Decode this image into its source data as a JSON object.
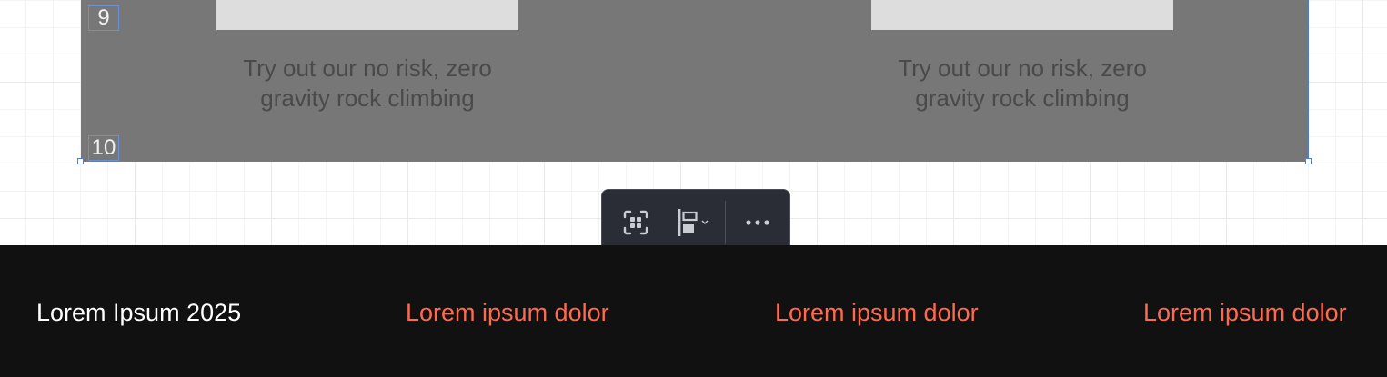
{
  "builder": {
    "row_numbers": [
      "9",
      "10"
    ],
    "cards": [
      {
        "caption_line1": "Try out our no risk, zero",
        "caption_line2": "gravity rock climbing"
      },
      {
        "caption_line1": "Try out our no risk, zero",
        "caption_line2": "gravity rock climbing"
      }
    ]
  },
  "toolbar": {
    "buttons": [
      {
        "icon": "select-frame-icon"
      },
      {
        "icon": "align-left-icon",
        "has_dropdown": true
      },
      {
        "icon": "more-horizontal-icon"
      }
    ]
  },
  "footer": {
    "title": "Lorem Ipsum 2025",
    "links": [
      "Lorem ipsum dolor",
      "Lorem ipsum dolor",
      "Lorem ipsum dolor"
    ],
    "link_color": "#ff6a4e",
    "background": "#111111"
  }
}
